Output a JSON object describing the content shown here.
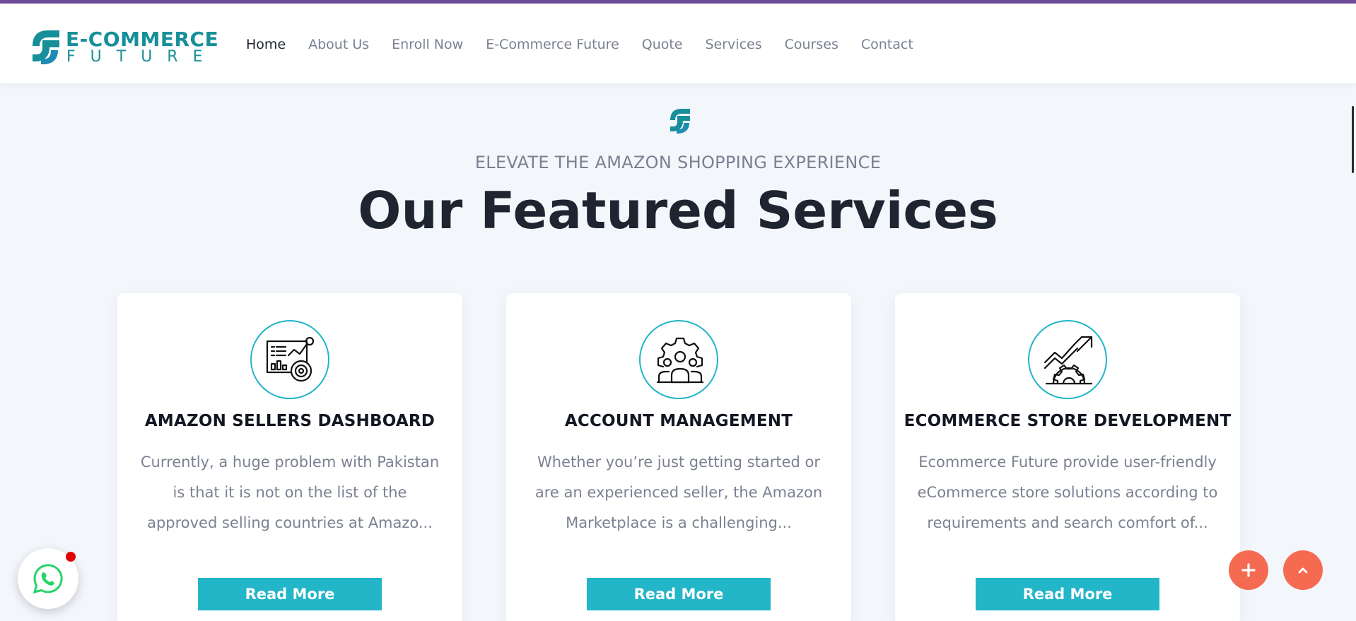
{
  "header": {
    "logo": {
      "line1": "E-COMMERCE",
      "line2": "FUTURE",
      "brand_color": "#168f99"
    },
    "nav": [
      {
        "label": "Home",
        "active": true
      },
      {
        "label": "About Us"
      },
      {
        "label": "Enroll Now"
      },
      {
        "label": "E-Commerce Future"
      },
      {
        "label": "Quote"
      },
      {
        "label": "Services"
      },
      {
        "label": "Courses"
      },
      {
        "label": "Contact"
      }
    ]
  },
  "section": {
    "eyebrow": "ELEVATE THE AMAZON SHOPPING EXPERIENCE",
    "title": "Our Featured Services"
  },
  "cards": [
    {
      "icon": "dashboard-chart-icon",
      "title": "AMAZON SELLERS DASHBOARD",
      "text": "Currently, a huge problem with Pakistan is that it is not on the list of the approved selling countries at Amazo...",
      "button": "Read More"
    },
    {
      "icon": "team-gear-icon",
      "title": "ACCOUNT MANAGEMENT",
      "text": "Whether you’re just getting started or are an experienced seller, the Amazon Marketplace is a challenging...",
      "button": "Read More"
    },
    {
      "icon": "growth-gear-icon",
      "title": "ECOMMERCE STORE DEVELOPMENT",
      "text": "Ecommerce Future provide user-friendly eCommerce store solutions according to requirements and search comfort of...",
      "button": "Read More"
    }
  ],
  "colors": {
    "accent": "#23b5c8",
    "fab": "#f56b52",
    "whatsapp": "#25d366",
    "top_strip": "#6e4c9a"
  }
}
